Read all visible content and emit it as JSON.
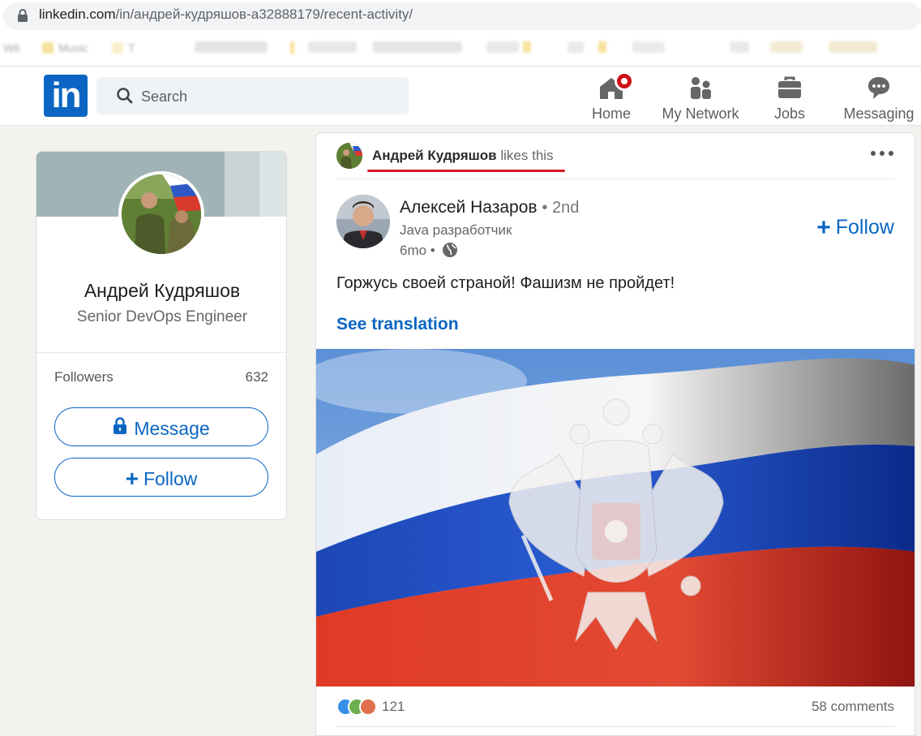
{
  "browser": {
    "url_host": "linkedin.com",
    "url_path": "/in/андрей-кудряшов-a32888179/recent-activity/",
    "bookmarks": [
      "Wit",
      "Music",
      "T"
    ]
  },
  "nav": {
    "search_placeholder": "Search",
    "items": [
      {
        "label": "Home",
        "icon": "home-icon"
      },
      {
        "label": "My Network",
        "icon": "network-icon"
      },
      {
        "label": "Jobs",
        "icon": "briefcase-icon"
      },
      {
        "label": "Messaging",
        "icon": "messaging-icon"
      }
    ]
  },
  "profile": {
    "name": "Андрей Кудряшов",
    "headline": "Senior DevOps Engineer",
    "followers_label": "Followers",
    "followers_count": "632",
    "message_label": "Message",
    "follow_label": "Follow"
  },
  "post": {
    "liker_name": "Андрей Кудряшов",
    "liker_action": "likes this",
    "author_name": "Алексей Назаров",
    "author_degree": "• 2nd",
    "author_headline": "Java разработчик",
    "time": "6mo •",
    "follow_label": "Follow",
    "text": "Горжусь своей страной! Фашизм не пройдет!",
    "see_translation": "See translation",
    "reaction_count": "121",
    "comments": "58 comments"
  },
  "colors": {
    "linkedin_blue": "#0a66c2",
    "notification_red": "#cc1016",
    "annotation_red": "#d9162a",
    "flag_white": "#ffffff",
    "flag_blue": "#1f4fbf",
    "flag_red": "#d92b1f"
  }
}
